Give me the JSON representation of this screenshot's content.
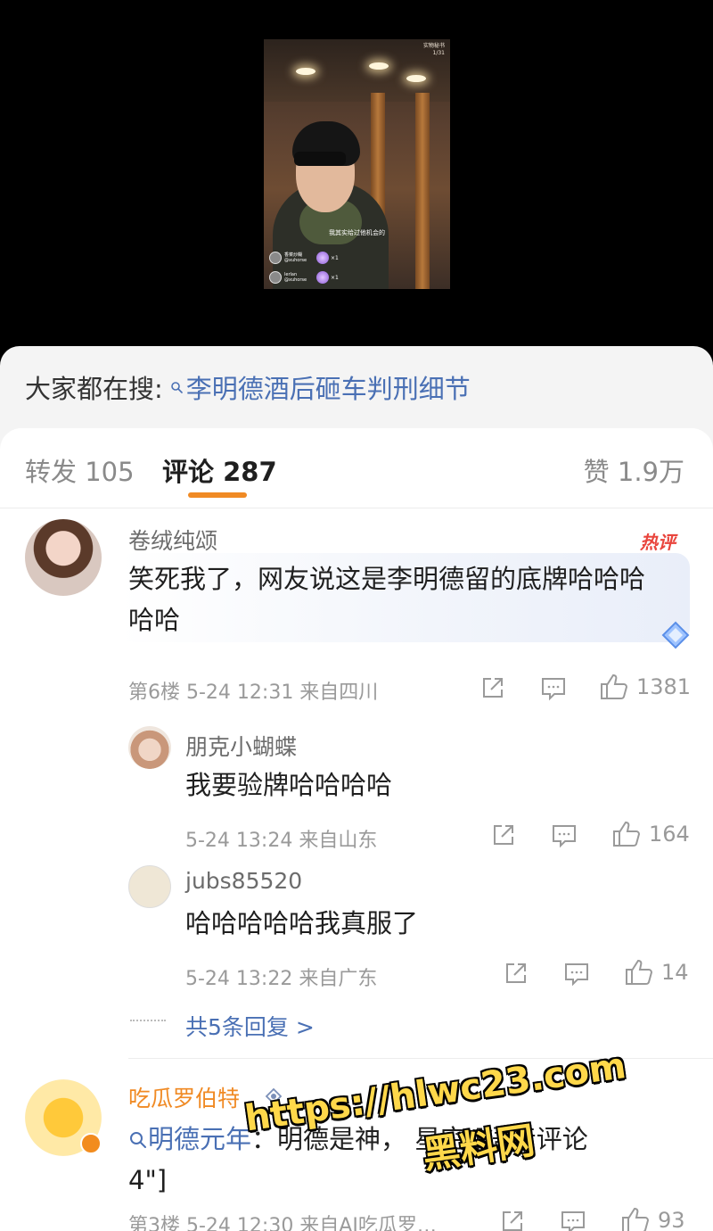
{
  "video": {
    "badge_line1": "实物秘书",
    "badge_line2": "1/31",
    "caption": "我其实给过他机会的",
    "gifts": [
      {
        "user": "香菜炒糊",
        "sub": "@xuhorse",
        "count": "×1"
      },
      {
        "user": "lerlan",
        "sub": "@xuhorse",
        "count": "×1"
      }
    ]
  },
  "search": {
    "prefix": "大家都在搜:",
    "query": "李明德酒后砸车判刑细节"
  },
  "tabs": {
    "repost": "转发 105",
    "comments": "评论 287",
    "likes": "赞 1.9万"
  },
  "comments": [
    {
      "user": "卷绒纯颂",
      "badge": "热评",
      "text_line1": "笑死我了，网友说这是李明德留的底牌哈哈哈",
      "text_line2": "哈哈",
      "meta": "第6楼 5-24 12:31 来自四川",
      "likes": "1381"
    },
    {
      "user": "吃瓜罗伯特",
      "text_tag": "明德元年",
      "text_rest": "：明德是神，  星空 [语音评论",
      "text_line2": "4\"]",
      "meta": "第3楼 5-24 12:30 来自AI吃瓜罗…",
      "likes": "93"
    }
  ],
  "replies": [
    {
      "user": "朋克小蝴蝶",
      "text": "我要验牌哈哈哈哈",
      "meta": "5-24 13:24 来自山东",
      "likes": "164"
    },
    {
      "user": "jubs85520",
      "text": "哈哈哈哈哈我真服了",
      "meta": "5-24 13:22 来自广东",
      "likes": "14"
    }
  ],
  "more_replies": "共5条回复 >",
  "watermark": {
    "line1": "https://hlwc23.com",
    "line2": "黑料网"
  },
  "colors": {
    "link_blue": "#4a70b4",
    "accent_orange": "#f08a24",
    "hot_red": "#e9453d",
    "watermark_yellow": "#ffd84a"
  }
}
